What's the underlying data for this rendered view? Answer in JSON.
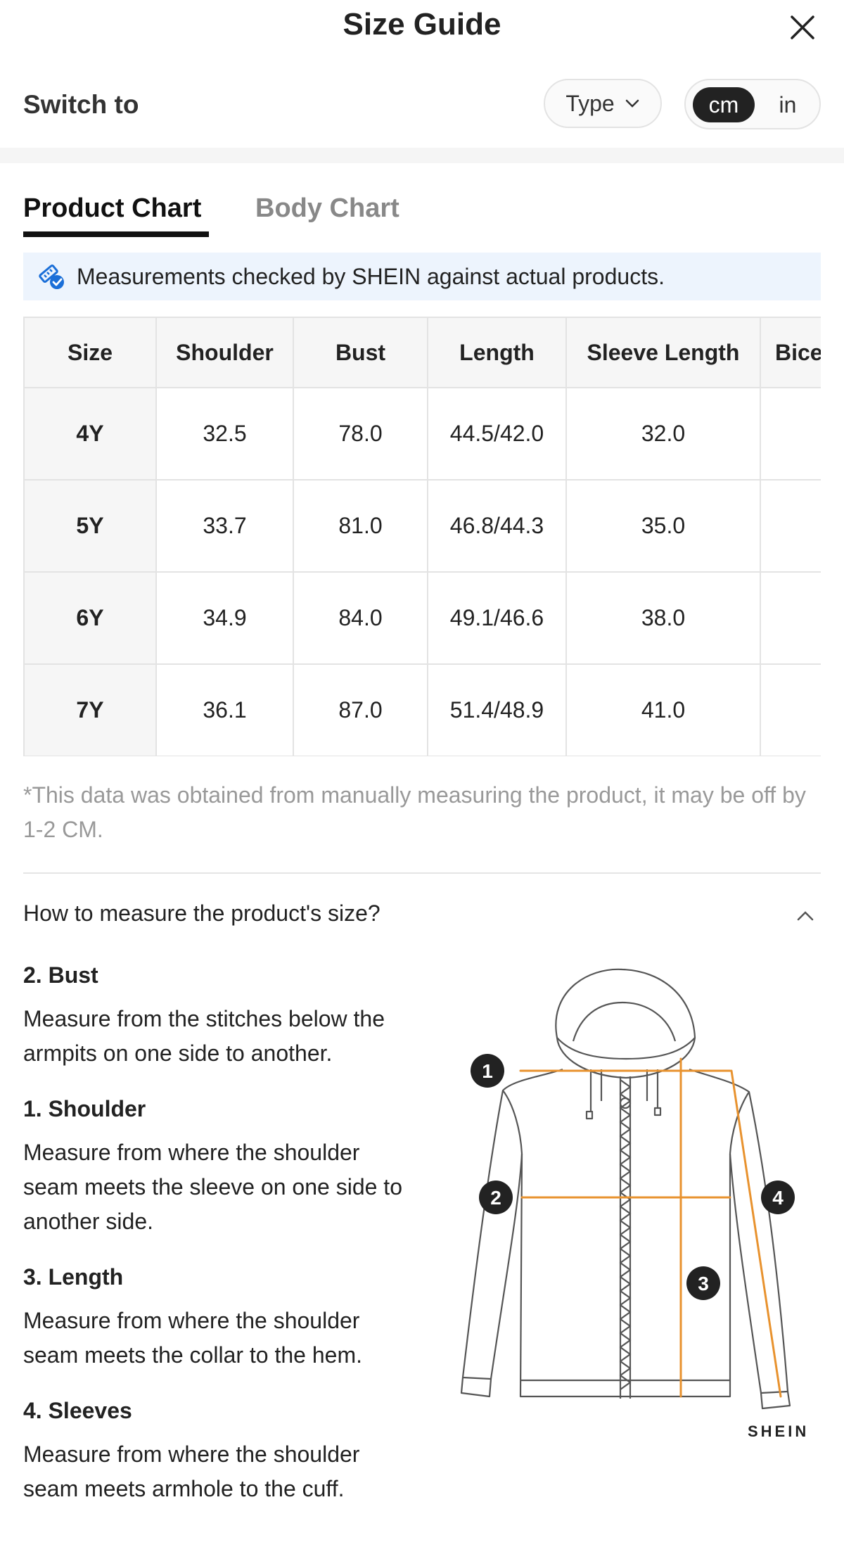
{
  "header": {
    "title": "Size Guide"
  },
  "switch": {
    "label": "Switch to",
    "type_button": "Type",
    "units": [
      "cm",
      "in"
    ],
    "selected_unit": "cm"
  },
  "tabs": [
    {
      "label": "Product Chart",
      "active": true
    },
    {
      "label": "Body Chart",
      "active": false
    }
  ],
  "notice": {
    "text": "Measurements checked by SHEIN against actual products."
  },
  "table": {
    "headers": [
      "Size",
      "Shoulder",
      "Bust",
      "Length",
      "Sleeve Length",
      "Bicep"
    ],
    "rows": [
      [
        "4Y",
        "32.5",
        "78.0",
        "44.5/42.0",
        "32.0",
        ""
      ],
      [
        "5Y",
        "33.7",
        "81.0",
        "46.8/44.3",
        "35.0",
        ""
      ],
      [
        "6Y",
        "34.9",
        "84.0",
        "49.1/46.6",
        "38.0",
        ""
      ],
      [
        "7Y",
        "36.1",
        "87.0",
        "51.4/48.9",
        "41.0",
        ""
      ]
    ]
  },
  "footnote": "*This data was obtained from manually measuring the product, it may be off by 1-2 CM.",
  "measure": {
    "question": "How to measure the product's size?",
    "items": [
      {
        "title": "2. Bust",
        "text": "Measure from the stitches below the armpits on one side to another."
      },
      {
        "title": "1. Shoulder",
        "text": "Measure from where the shoulder seam meets the sleeve on one side to another side."
      },
      {
        "title": "3. Length",
        "text": "Measure from where the shoulder seam meets the collar to the hem."
      },
      {
        "title": "4. Sleeves",
        "text": "Measure from where the shoulder seam meets armhole to the cuff."
      }
    ],
    "markers": [
      "1",
      "2",
      "3",
      "4"
    ],
    "brand": "SHEIN"
  },
  "colors": {
    "accent_line": "#e8922e",
    "active_tab": "#111111",
    "notice_bg": "#edf4fd",
    "notice_icon": "#1b6fd8"
  }
}
